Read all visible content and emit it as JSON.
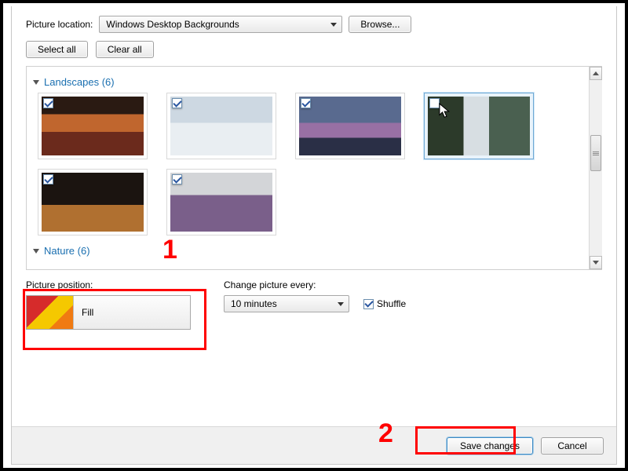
{
  "top": {
    "picture_location_label": "Picture location:",
    "location_select_value": "Windows Desktop Backgrounds",
    "browse_label": "Browse...",
    "select_all_label": "Select all",
    "clear_all_label": "Clear all"
  },
  "categories": [
    {
      "name": "Landscapes",
      "count": 6,
      "display": "Landscapes (6)"
    },
    {
      "name": "Nature",
      "count": 6,
      "display": "Nature (6)"
    }
  ],
  "thumbnails_row1": [
    {
      "style": "canyon",
      "checked": true
    },
    {
      "style": "ice",
      "checked": true
    },
    {
      "style": "coast",
      "checked": true
    },
    {
      "style": "waterfall",
      "checked": false,
      "selected": true,
      "cursor": true
    }
  ],
  "thumbnails_row2": [
    {
      "style": "arch",
      "checked": true
    },
    {
      "style": "lavender",
      "checked": true
    }
  ],
  "position": {
    "label": "Picture position:",
    "value": "Fill"
  },
  "interval": {
    "label": "Change picture every:",
    "value": "10 minutes"
  },
  "shuffle": {
    "label": "Shuffle",
    "checked": true
  },
  "footer": {
    "save_label": "Save changes",
    "cancel_label": "Cancel"
  },
  "annotations": {
    "one": "1",
    "two": "2"
  }
}
